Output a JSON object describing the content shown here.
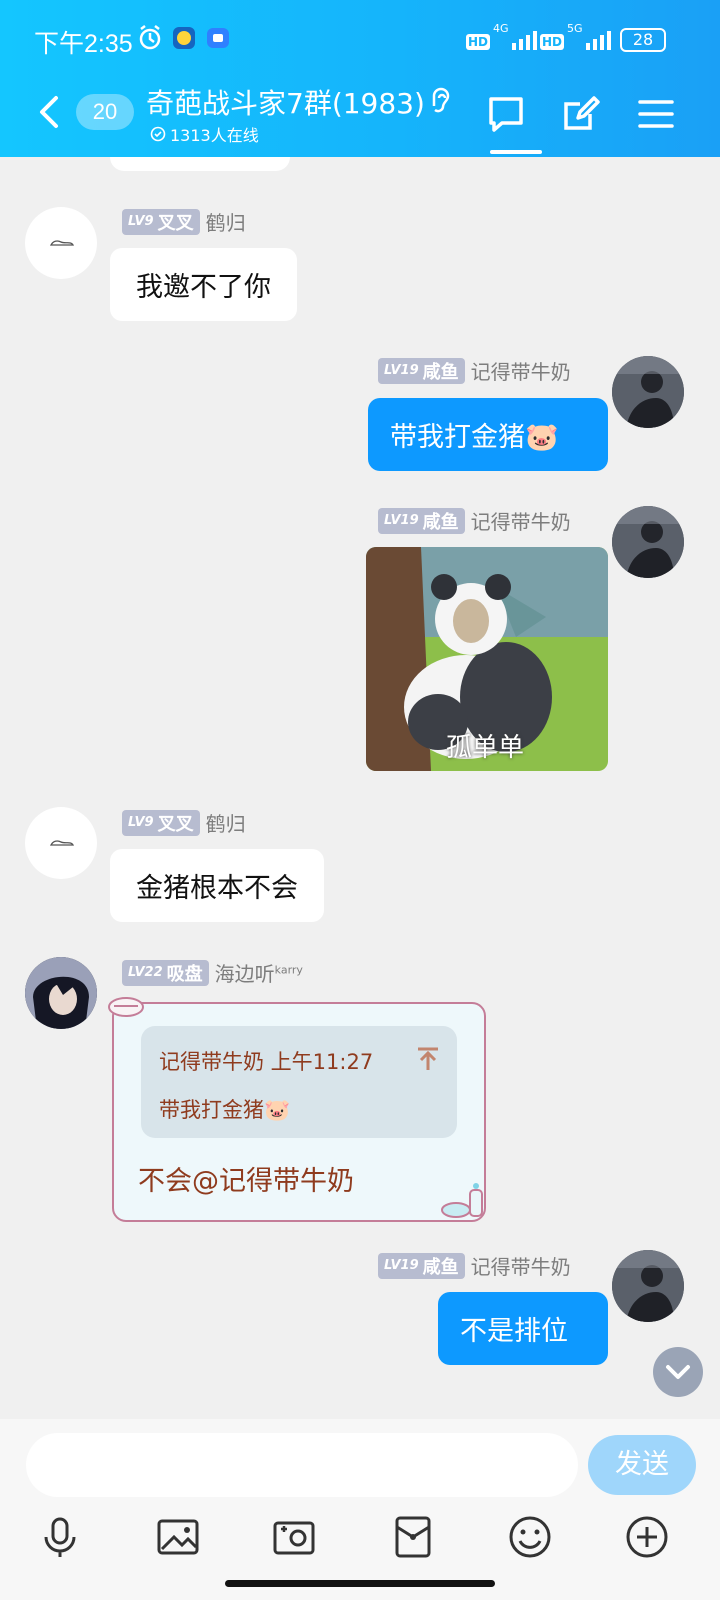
{
  "status_bar": {
    "time": "下午2:35",
    "sim1_network": "4G",
    "sim2_network": "5G",
    "hd_label": "HD",
    "battery": "28"
  },
  "header": {
    "unread_count": "20",
    "group_name": "奇葩战斗家7群(1983)",
    "online_count": "1313人在线"
  },
  "messages": [
    {
      "side": "left",
      "level": "LV9",
      "title": "叉叉",
      "name": "鹤归",
      "text": "我邀不了你"
    },
    {
      "side": "right",
      "level": "LV19",
      "title": "咸鱼",
      "name": "记得带牛奶",
      "text": "带我打金猪🐷"
    },
    {
      "side": "right",
      "level": "LV19",
      "title": "咸鱼",
      "name": "记得带牛奶",
      "sticker_caption": "孤单单"
    },
    {
      "side": "left",
      "level": "LV9",
      "title": "叉叉",
      "name": "鹤归",
      "text": "金猪根本不会"
    },
    {
      "side": "left",
      "level": "LV22",
      "title": "吸盘",
      "name": "海边听",
      "name_sup": "karry",
      "quote": {
        "author_time": "记得带牛奶  上午11:27",
        "text": "带我打金猪🐷"
      },
      "text": "不会@记得带牛奶"
    },
    {
      "side": "right",
      "level": "LV19",
      "title": "咸鱼",
      "name": "记得带牛奶",
      "text": "不是排位"
    }
  ],
  "input": {
    "placeholder": "",
    "send_label": "发送"
  },
  "toolbar": [
    "mic-icon",
    "image-icon",
    "camera-icon",
    "red-packet-icon",
    "emoji-icon",
    "plus-icon"
  ],
  "colors": {
    "header": "#15b4fb",
    "bubble_blue": "#0d99ff",
    "send_disabled": "#9fd6fb"
  }
}
